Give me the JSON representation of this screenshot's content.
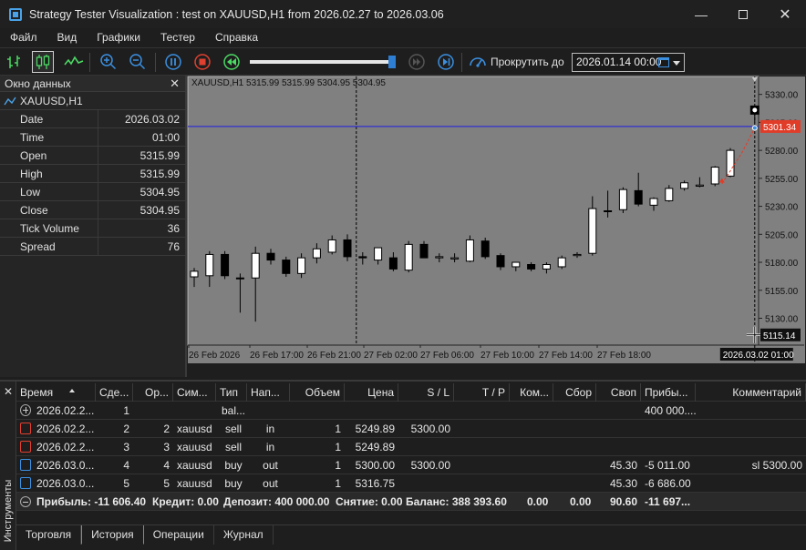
{
  "window": {
    "title": "Strategy Tester Visualization : test on XAUUSD,H1 from 2026.02.27 to 2026.03.06"
  },
  "menu": [
    "Файл",
    "Вид",
    "Графики",
    "Тестер",
    "Справка"
  ],
  "toolbar": {
    "scroll_label": "Прокрутить до",
    "scroll_date": "2026.01.14 00:00",
    "speed_percent": 98
  },
  "data_window": {
    "title": "Окно данных",
    "symbol": "XAUUSD,H1",
    "rows": [
      {
        "k": "Date",
        "v": "2026.03.02"
      },
      {
        "k": "Time",
        "v": "01:00"
      },
      {
        "k": "Open",
        "v": "5315.99"
      },
      {
        "k": "High",
        "v": "5315.99"
      },
      {
        "k": "Low",
        "v": "5304.95"
      },
      {
        "k": "Close",
        "v": "5304.95"
      },
      {
        "k": "Tick Volume",
        "v": "36"
      },
      {
        "k": "Spread",
        "v": "76"
      }
    ]
  },
  "chart": {
    "header": "XAUUSD,H1  5315.99 5315.99 5304.95 5304.95",
    "red_price_label": "5301.34",
    "cursor_price_label": "5115.14",
    "cursor_time_label": "2026.03.02 01:00",
    "colors": {
      "bg": "#808080",
      "bull_body": "#ffffff",
      "bear_body": "#000000",
      "hline_blue": "#2f2fd0",
      "price_red": "#e03c28"
    }
  },
  "chart_data": {
    "type": "candlestick",
    "y_ticks": [
      "5330.00",
      "5305.00",
      "5280.00",
      "5255.00",
      "5230.00",
      "5205.00",
      "5180.00",
      "5155.00",
      "5130.00"
    ],
    "x_ticks": [
      "26 Feb 2026",
      "26 Feb 17:00",
      "26 Feb 21:00",
      "27 Feb 02:00",
      "27 Feb 06:00",
      "27 Feb 10:00",
      "27 Feb 14:00",
      "27 Feb 18:00"
    ],
    "ylim": [
      5106,
      5346
    ],
    "hline": 5301.34,
    "candles": [
      {
        "o": 5167,
        "h": 5175,
        "l": 5158,
        "c": 5172
      },
      {
        "o": 5168,
        "h": 5190,
        "l": 5158,
        "c": 5187
      },
      {
        "o": 5187,
        "h": 5190,
        "l": 5165,
        "c": 5168
      },
      {
        "o": 5166,
        "h": 5170,
        "l": 5135,
        "c": 5166
      },
      {
        "o": 5166,
        "h": 5194,
        "l": 5127,
        "c": 5188
      },
      {
        "o": 5188,
        "h": 5192,
        "l": 5178,
        "c": 5182
      },
      {
        "o": 5182,
        "h": 5185,
        "l": 5167,
        "c": 5170
      },
      {
        "o": 5170,
        "h": 5188,
        "l": 5166,
        "c": 5184
      },
      {
        "o": 5184,
        "h": 5197,
        "l": 5179,
        "c": 5192
      },
      {
        "o": 5189,
        "h": 5204,
        "l": 5187,
        "c": 5200
      },
      {
        "o": 5200,
        "h": 5205,
        "l": 5181,
        "c": 5185
      },
      {
        "o": 5185,
        "h": 5189,
        "l": 5178,
        "c": 5184
      },
      {
        "o": 5182,
        "h": 5189,
        "l": 5178,
        "c": 5193
      },
      {
        "o": 5184,
        "h": 5189,
        "l": 5172,
        "c": 5174
      },
      {
        "o": 5173,
        "h": 5199,
        "l": 5171,
        "c": 5196
      },
      {
        "o": 5196,
        "h": 5199,
        "l": 5185,
        "c": 5184
      },
      {
        "o": 5184,
        "h": 5188,
        "l": 5180,
        "c": 5185
      },
      {
        "o": 5183,
        "h": 5188,
        "l": 5180,
        "c": 5184
      },
      {
        "o": 5181,
        "h": 5204,
        "l": 5180,
        "c": 5200
      },
      {
        "o": 5199,
        "h": 5202,
        "l": 5183,
        "c": 5185
      },
      {
        "o": 5186,
        "h": 5188,
        "l": 5173,
        "c": 5176
      },
      {
        "o": 5176,
        "h": 5180,
        "l": 5172,
        "c": 5180
      },
      {
        "o": 5178,
        "h": 5180,
        "l": 5172,
        "c": 5174
      },
      {
        "o": 5174,
        "h": 5180,
        "l": 5170,
        "c": 5178
      },
      {
        "o": 5176,
        "h": 5186,
        "l": 5174,
        "c": 5184
      },
      {
        "o": 5186,
        "h": 5189,
        "l": 5184,
        "c": 5187
      },
      {
        "o": 5188,
        "h": 5239,
        "l": 5186,
        "c": 5228
      },
      {
        "o": 5226,
        "h": 5244,
        "l": 5220,
        "c": 5226
      },
      {
        "o": 5227,
        "h": 5247,
        "l": 5224,
        "c": 5245
      },
      {
        "o": 5244,
        "h": 5260,
        "l": 5230,
        "c": 5232
      },
      {
        "o": 5231,
        "h": 5238,
        "l": 5226,
        "c": 5237
      },
      {
        "o": 5235,
        "h": 5249,
        "l": 5234,
        "c": 5246
      },
      {
        "o": 5246,
        "h": 5253,
        "l": 5244,
        "c": 5251
      },
      {
        "o": 5248,
        "h": 5256,
        "l": 5247,
        "c": 5249
      },
      {
        "o": 5250,
        "h": 5266,
        "l": 5248,
        "c": 5265
      },
      {
        "o": 5257,
        "h": 5282,
        "l": 5256,
        "c": 5280
      }
    ],
    "current_candle": {
      "o": 5315.99,
      "h": 5315.99,
      "l": 5304.95,
      "c": 5304.95
    }
  },
  "bottom": {
    "columns": [
      "Время",
      "Сде...",
      "Ор...",
      "Сим...",
      "Тип",
      "Нап...",
      "Объем",
      "Цена",
      "S / L",
      "T / P",
      "Ком...",
      "Сбор",
      "Своп",
      "Прибы...",
      "Комментарий"
    ],
    "rows": [
      [
        "2026.02.2...",
        "1",
        "",
        "",
        "bal...",
        "",
        "",
        "",
        "",
        "",
        "",
        "",
        "",
        "400 000....",
        ""
      ],
      [
        "2026.02.2...",
        "2",
        "2",
        "xauusd",
        "sell",
        "in",
        "1",
        "5249.89",
        "5300.00",
        "",
        "",
        "",
        "",
        "",
        ""
      ],
      [
        "2026.02.2...",
        "3",
        "3",
        "xauusd",
        "sell",
        "in",
        "1",
        "5249.89",
        "",
        "",
        "",
        "",
        "",
        "",
        ""
      ],
      [
        "2026.03.0...",
        "4",
        "4",
        "xauusd",
        "buy",
        "out",
        "1",
        "5300.00",
        "5300.00",
        "",
        "",
        "",
        "45.30",
        "-5 011.00",
        "sl 5300.00"
      ],
      [
        "2026.03.0...",
        "5",
        "5",
        "xauusd",
        "buy",
        "out",
        "1",
        "5316.75",
        "",
        "",
        "",
        "",
        "45.30",
        "-6 686.00",
        ""
      ]
    ],
    "row_icons": [
      "balance-icon",
      "sell-icon",
      "sell-icon",
      "buy-icon",
      "buy-icon"
    ],
    "summary": {
      "profit": "Прибыль: -11 606.40",
      "credit": "Кредит: 0.00",
      "deposit": "Депозит: 400 000.00",
      "withdraw": "Снятие: 0.00",
      "balance": "Баланс: 388 393.60",
      "kom": "0.00",
      "sbor": "0.00",
      "swap": "90.60",
      "total": "-11 697..."
    },
    "tabs": [
      "Торговля",
      "История",
      "Операции",
      "Журнал"
    ],
    "active_tab": 1,
    "side_label": "Инструменты"
  }
}
